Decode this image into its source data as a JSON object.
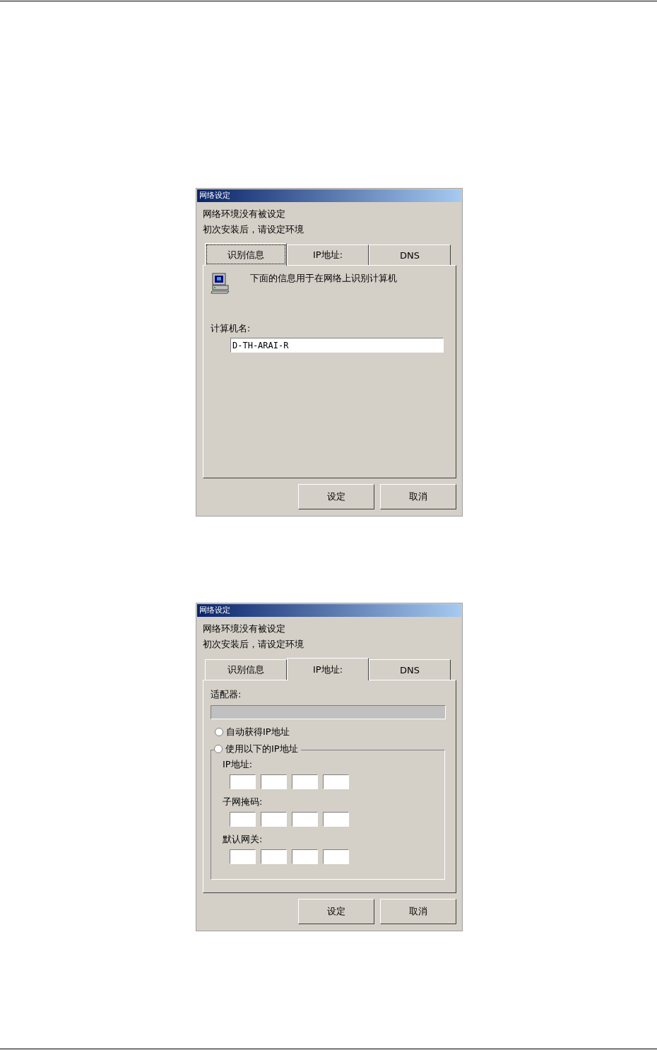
{
  "dialogs": [
    {
      "title": "网络设定",
      "message_lines": [
        "网络环境没有被设定",
        "初次安装后，请设定环境"
      ],
      "tabs": [
        {
          "label": "识别信息",
          "selected": true
        },
        {
          "label": "IP地址:",
          "selected": false
        },
        {
          "label": "DNS",
          "selected": false
        }
      ],
      "panel": {
        "kind": "identity",
        "description": "下面的信息用于在网络上识别计算机",
        "field_label": "计算机名:",
        "field_value": "D-TH-ARAI-R"
      },
      "buttons": [
        "设定",
        "取消"
      ]
    },
    {
      "title": "网络设定",
      "message_lines": [
        "网络环境没有被设定",
        "初次安装后，请设定环境"
      ],
      "tabs": [
        {
          "label": "识别信息",
          "selected": false
        },
        {
          "label": "IP地址:",
          "selected": true
        },
        {
          "label": "DNS",
          "selected": false
        }
      ],
      "panel": {
        "kind": "ip",
        "adapter_label": "适配器:",
        "radios": [
          {
            "label": "自动获得IP地址",
            "selected": false
          },
          {
            "label": "使用以下的IP地址",
            "selected": false
          }
        ],
        "address_fields": [
          {
            "label": "IP地址:"
          },
          {
            "label": "子网掩码:"
          },
          {
            "label": "默认网关:"
          }
        ]
      },
      "buttons": [
        "设定",
        "取消"
      ]
    }
  ]
}
